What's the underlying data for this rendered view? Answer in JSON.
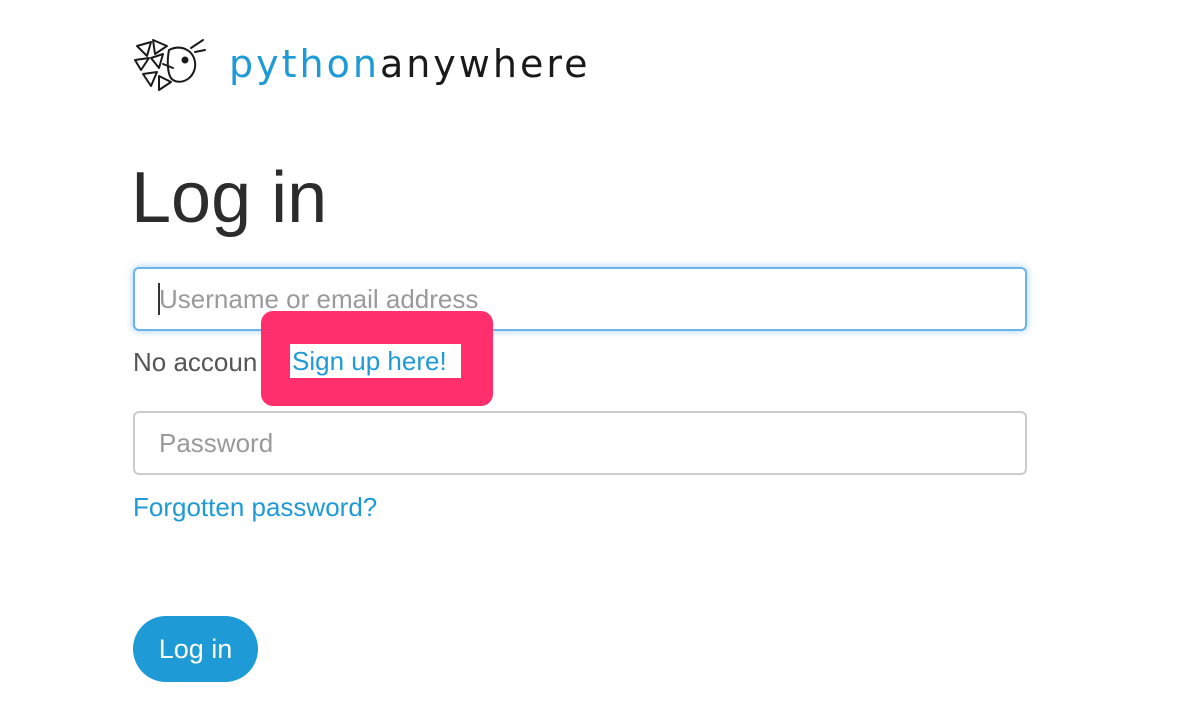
{
  "brand": {
    "name_part1": "python",
    "name_part2": "anywhere",
    "logo_icon": "pythonanywhere-logo-icon",
    "accent_color": "#1e9ad6"
  },
  "page": {
    "title": "Log in"
  },
  "form": {
    "username_placeholder": "Username or email address",
    "username_value": "",
    "password_placeholder": "Password",
    "password_value": "",
    "signup_prefix": "No accoun",
    "signup_link": "Sign up here!",
    "forgot_link": "Forgotten password?",
    "submit_label": "Log in"
  },
  "annotation": {
    "highlight_color": "#ff2e6c"
  }
}
